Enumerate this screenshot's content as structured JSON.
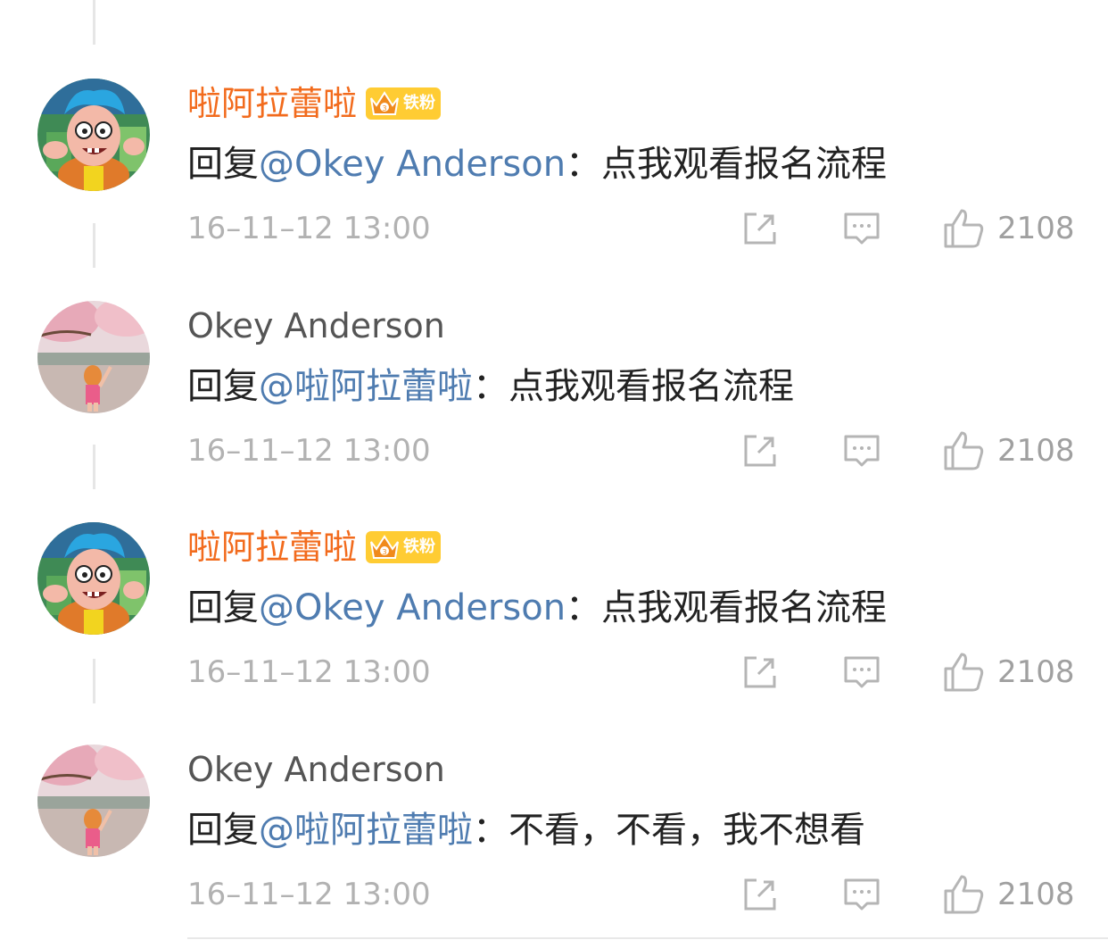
{
  "comments": [
    {
      "username": "啦阿拉蕾啦",
      "badge": "铁粉",
      "reply_prefix": "回复",
      "mention": "@Okey Anderson",
      "separator": "：",
      "text": "点我观看报名流程",
      "timestamp": "16–11–12 13:00",
      "likes": "2108"
    },
    {
      "username": "Okey Anderson",
      "reply_prefix": "回复",
      "mention": "@啦阿拉蕾啦",
      "separator": "：",
      "text": "点我观看报名流程",
      "timestamp": "16–11–12 13:00",
      "likes": "2108"
    },
    {
      "username": "啦阿拉蕾啦",
      "badge": "铁粉",
      "reply_prefix": "回复",
      "mention": "@Okey Anderson",
      "separator": "：",
      "text": "点我观看报名流程",
      "timestamp": "16–11–12 13:00",
      "likes": "2108"
    },
    {
      "username": "Okey Anderson",
      "reply_prefix": "回复",
      "mention": "@啦阿拉蕾啦",
      "separator": "：",
      "text": "不看，不看，我不想看",
      "timestamp": "16–11–12 13:00",
      "likes": "2108"
    }
  ],
  "colors": {
    "username_highlight": "#f26b1d",
    "username_default": "#555555",
    "mention": "#4f7cb0",
    "meta_text": "#b2b2b2",
    "badge_bg": "#ffcc33"
  },
  "icons": {
    "share": "share-icon",
    "reply": "comment-icon",
    "like": "thumbs-up-icon"
  }
}
